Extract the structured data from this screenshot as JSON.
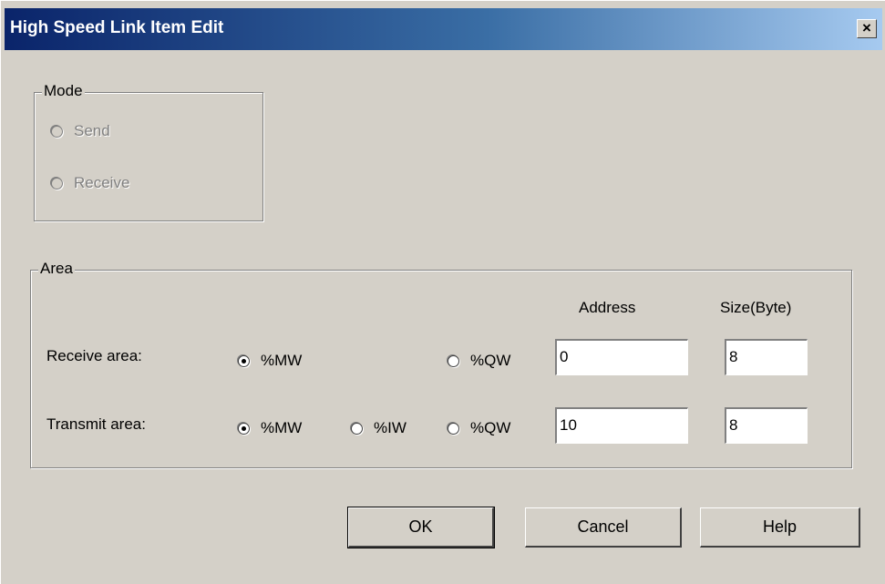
{
  "window": {
    "title": "High Speed Link Item Edit",
    "close_label": "×"
  },
  "mode": {
    "group_label": "Mode",
    "options": [
      {
        "label": "Send",
        "checked": false,
        "disabled": true
      },
      {
        "label": "Receive",
        "checked": false,
        "disabled": true
      }
    ]
  },
  "area": {
    "group_label": "Area",
    "headers": {
      "address": "Address",
      "size": "Size(Byte)"
    },
    "receive": {
      "label": "Receive area:",
      "options": [
        {
          "label": "%MW",
          "checked": true
        },
        {
          "label": "%QW",
          "checked": false
        }
      ],
      "address": "0",
      "size": "8"
    },
    "transmit": {
      "label": "Transmit area:",
      "options": [
        {
          "label": "%MW",
          "checked": true
        },
        {
          "label": "%IW",
          "checked": false
        },
        {
          "label": "%QW",
          "checked": false
        }
      ],
      "address": "10",
      "size": "8"
    }
  },
  "buttons": {
    "ok": "OK",
    "cancel": "Cancel",
    "help": "Help"
  }
}
